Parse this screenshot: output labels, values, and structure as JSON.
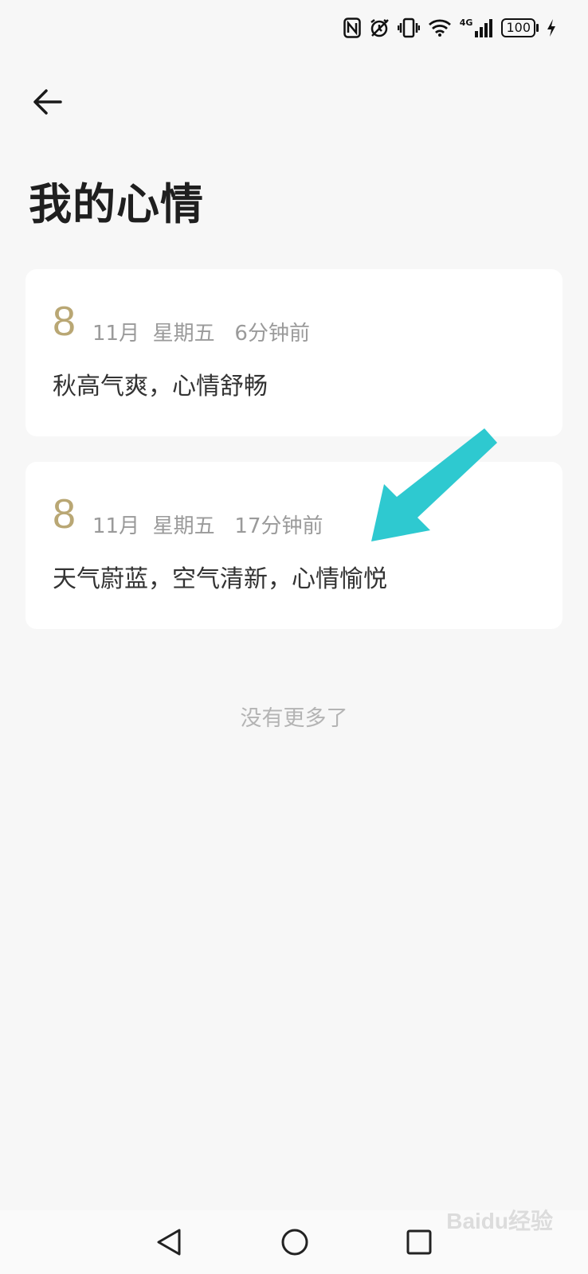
{
  "status_bar": {
    "icons": [
      "nfc-icon",
      "alarm-icon",
      "vibrate-icon",
      "wifi-icon",
      "signal-4g-icon"
    ],
    "network_label": "4G",
    "battery_level": "100"
  },
  "header": {
    "title": "我的心情"
  },
  "moods": [
    {
      "day": "8",
      "meta": "11月  星期五   6分钟前",
      "text": "秋高气爽，心情舒畅"
    },
    {
      "day": "8",
      "meta": "11月  星期五   17分钟前",
      "text": "天气蔚蓝，空气清新，心情愉悦"
    }
  ],
  "list_footer": "没有更多了",
  "annotation": {
    "color": "#2ec9d0"
  },
  "colors": {
    "day_accent": "#b9a774",
    "background": "#f7f7f7"
  },
  "watermark": "Baidu经验"
}
